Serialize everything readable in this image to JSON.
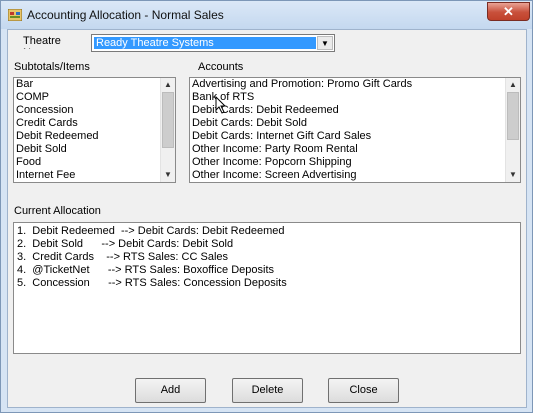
{
  "window": {
    "title": "Accounting Allocation - Normal Sales",
    "close_icon": "close-icon"
  },
  "theatre": {
    "label": "Theatre Name",
    "selected": "Ready Theatre Systems"
  },
  "subtotals": {
    "label": "Subtotals/Items",
    "items": [
      "Bar",
      "COMP",
      "Concession",
      "Credit Cards",
      "Debit Redeemed",
      "Debit Sold",
      "Food",
      "Internet Fee"
    ]
  },
  "accounts": {
    "label": "Accounts",
    "items": [
      "Advertising and Promotion: Promo Gift Cards",
      "Bank of RTS",
      "Debit Cards: Debit Redeemed",
      "Debit Cards: Debit Sold",
      "Debit Cards: Internet Gift Card Sales",
      "Other Income: Party Room Rental",
      "Other Income: Popcorn Shipping",
      "Other Income: Screen Advertising"
    ]
  },
  "allocation": {
    "label": "Current Allocation",
    "lines": [
      "1.  Debit Redeemed  --> Debit Cards: Debit Redeemed",
      "2.  Debit Sold      --> Debit Cards: Debit Sold",
      "3.  Credit Cards    --> RTS Sales: CC Sales",
      "4.  @TicketNet      --> RTS Sales: Boxoffice Deposits",
      "5.  Concession      --> RTS Sales: Concession Deposits"
    ]
  },
  "buttons": {
    "add": "Add",
    "delete": "Delete",
    "close": "Close"
  }
}
